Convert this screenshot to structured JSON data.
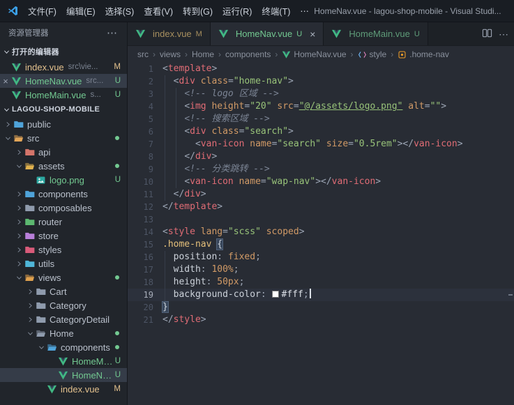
{
  "window": {
    "title": "HomeNav.vue - lagou-shop-mobile - Visual Studi..."
  },
  "menu_bar": {
    "items": [
      "文件(F)",
      "编辑(E)",
      "选择(S)",
      "查看(V)",
      "转到(G)",
      "运行(R)",
      "终端(T)",
      "⋯"
    ]
  },
  "icons": {
    "close": "×",
    "more": "⋯",
    "chevron_right": "›",
    "chevron_down": "⌄"
  },
  "colors": {
    "modified": "#E2C08D",
    "untracked": "#73C991",
    "accent_blue": "#3BA0E8",
    "editor_bg": "#282c34",
    "sidebar_bg": "#21252b",
    "tag": "#e06c75",
    "attribute": "#d19a66",
    "string": "#98c379",
    "selector": "#e5c07b"
  },
  "sidebar": {
    "title": "资源管理器",
    "sections": {
      "open_editors": "打开的编辑器",
      "project": "LAGOU-SHOP-MOBILE"
    },
    "open_editors": [
      {
        "name": "index.vue",
        "path": "src\\vie...",
        "badge": "M",
        "status": "m",
        "active": false
      },
      {
        "name": "HomeNav.vue",
        "path": "src...",
        "badge": "U",
        "status": "u",
        "active": true
      },
      {
        "name": "HomeMain.vue",
        "path": "s...",
        "badge": "U",
        "status": "u",
        "active": false
      }
    ],
    "tree": [
      {
        "label": "public",
        "depth": 0,
        "kind": "folder",
        "open": false,
        "color": "#4FA3D9"
      },
      {
        "label": "src",
        "depth": 0,
        "kind": "folder",
        "open": true,
        "color": "#E2A558",
        "dot": true
      },
      {
        "label": "api",
        "depth": 1,
        "kind": "folder",
        "open": false,
        "color": "#D4756A"
      },
      {
        "label": "assets",
        "depth": 1,
        "kind": "folder",
        "open": true,
        "color": "#E0B14E",
        "dot": true
      },
      {
        "label": "logo.png",
        "depth": 2,
        "kind": "file",
        "icon": "image",
        "badge": "U",
        "status": "u"
      },
      {
        "label": "components",
        "depth": 1,
        "kind": "folder",
        "open": false,
        "color": "#4FA3D9"
      },
      {
        "label": "composables",
        "depth": 1,
        "kind": "folder",
        "open": false,
        "color": "#8F9BAD"
      },
      {
        "label": "router",
        "depth": 1,
        "kind": "folder",
        "open": false,
        "color": "#5CB870"
      },
      {
        "label": "store",
        "depth": 1,
        "kind": "folder",
        "open": false,
        "color": "#B87FD9"
      },
      {
        "label": "styles",
        "depth": 1,
        "kind": "folder",
        "open": false,
        "color": "#D95B7A"
      },
      {
        "label": "utils",
        "depth": 1,
        "kind": "folder",
        "open": false,
        "color": "#4FB6D8"
      },
      {
        "label": "views",
        "depth": 1,
        "kind": "folder",
        "open": true,
        "color": "#E0A14E",
        "dot": true
      },
      {
        "label": "Cart",
        "depth": 2,
        "kind": "folder",
        "open": false,
        "color": "#8F9BAD"
      },
      {
        "label": "Category",
        "depth": 2,
        "kind": "folder",
        "open": false,
        "color": "#8F9BAD"
      },
      {
        "label": "CategoryDetail",
        "depth": 2,
        "kind": "folder",
        "open": false,
        "color": "#8F9BAD"
      },
      {
        "label": "Home",
        "depth": 2,
        "kind": "folder",
        "open": true,
        "color": "#8F9BAD",
        "dot": true
      },
      {
        "label": "components",
        "depth": 3,
        "kind": "folder",
        "open": true,
        "color": "#4FA3D9",
        "dot": true
      },
      {
        "label": "HomeMain...",
        "depth": 4,
        "kind": "file",
        "icon": "vue",
        "badge": "U",
        "status": "u"
      },
      {
        "label": "HomeNav.v...",
        "depth": 4,
        "kind": "file",
        "icon": "vue",
        "badge": "U",
        "status": "u",
        "selected": true
      },
      {
        "label": "index.vue",
        "depth": 3,
        "kind": "file",
        "icon": "vue",
        "badge": "M",
        "status": "m"
      }
    ]
  },
  "tabs": [
    {
      "label": "index.vue",
      "badge": "M",
      "status": "m",
      "active": false
    },
    {
      "label": "HomeNav.vue",
      "badge": "U",
      "status": "u",
      "active": true
    },
    {
      "label": "HomeMain.vue",
      "badge": "U",
      "status": "u",
      "active": false
    }
  ],
  "breadcrumb": {
    "items": [
      {
        "label": "src"
      },
      {
        "label": "views"
      },
      {
        "label": "Home"
      },
      {
        "label": "components"
      },
      {
        "label": "HomeNav.vue",
        "icon": "vue"
      },
      {
        "label": "style",
        "icon": "symbol-style"
      },
      {
        "label": ".home-nav",
        "icon": "symbol-class"
      }
    ]
  },
  "editor": {
    "lines": [
      {
        "n": 1,
        "t": [
          [
            "p",
            "<"
          ],
          [
            "g",
            "template"
          ],
          [
            "p",
            ">"
          ]
        ]
      },
      {
        "n": 2,
        "t": [
          [
            "ws",
            "  "
          ],
          [
            "p",
            "<"
          ],
          [
            "g",
            "div"
          ],
          [
            "ws",
            " "
          ],
          [
            "a",
            "class"
          ],
          [
            "p",
            "="
          ],
          [
            "s",
            "\"home-nav\""
          ],
          [
            "p",
            ">"
          ]
        ]
      },
      {
        "n": 3,
        "t": [
          [
            "ws",
            "    "
          ],
          [
            "cm",
            "<!-- logo 区域 -->"
          ]
        ]
      },
      {
        "n": 4,
        "t": [
          [
            "ws",
            "    "
          ],
          [
            "p",
            "<"
          ],
          [
            "g",
            "img"
          ],
          [
            "ws",
            " "
          ],
          [
            "a",
            "height"
          ],
          [
            "p",
            "="
          ],
          [
            "s",
            "\"20\""
          ],
          [
            "ws",
            " "
          ],
          [
            "a",
            "src"
          ],
          [
            "p",
            "="
          ],
          [
            "sl",
            "\"@/assets/logo.png\""
          ],
          [
            "ws",
            " "
          ],
          [
            "a",
            "alt"
          ],
          [
            "p",
            "="
          ],
          [
            "s",
            "\"\""
          ],
          [
            "p",
            ">"
          ]
        ]
      },
      {
        "n": 5,
        "t": [
          [
            "ws",
            "    "
          ],
          [
            "cm",
            "<!-- 搜索区域 -->"
          ]
        ]
      },
      {
        "n": 6,
        "t": [
          [
            "ws",
            "    "
          ],
          [
            "p",
            "<"
          ],
          [
            "g",
            "div"
          ],
          [
            "ws",
            " "
          ],
          [
            "a",
            "class"
          ],
          [
            "p",
            "="
          ],
          [
            "s",
            "\"search\""
          ],
          [
            "p",
            ">"
          ]
        ]
      },
      {
        "n": 7,
        "t": [
          [
            "ws",
            "      "
          ],
          [
            "p",
            "<"
          ],
          [
            "g",
            "van-icon"
          ],
          [
            "ws",
            " "
          ],
          [
            "a",
            "name"
          ],
          [
            "p",
            "="
          ],
          [
            "s",
            "\"search\""
          ],
          [
            "ws",
            " "
          ],
          [
            "a",
            "size"
          ],
          [
            "p",
            "="
          ],
          [
            "s",
            "\"0.5rem\""
          ],
          [
            "p",
            "></"
          ],
          [
            "g",
            "van-icon"
          ],
          [
            "p",
            ">"
          ]
        ]
      },
      {
        "n": 8,
        "t": [
          [
            "ws",
            "    "
          ],
          [
            "p",
            "</"
          ],
          [
            "g",
            "div"
          ],
          [
            "p",
            ">"
          ]
        ]
      },
      {
        "n": 9,
        "t": [
          [
            "ws",
            "    "
          ],
          [
            "cm",
            "<!-- 分类跳转 -->"
          ]
        ]
      },
      {
        "n": 10,
        "t": [
          [
            "ws",
            "    "
          ],
          [
            "p",
            "<"
          ],
          [
            "g",
            "van-icon"
          ],
          [
            "ws",
            " "
          ],
          [
            "a",
            "name"
          ],
          [
            "p",
            "="
          ],
          [
            "s",
            "\"wap-nav\""
          ],
          [
            "p",
            "></"
          ],
          [
            "g",
            "van-icon"
          ],
          [
            "p",
            ">"
          ]
        ]
      },
      {
        "n": 11,
        "t": [
          [
            "ws",
            "  "
          ],
          [
            "p",
            "</"
          ],
          [
            "g",
            "div"
          ],
          [
            "p",
            ">"
          ]
        ]
      },
      {
        "n": 12,
        "t": [
          [
            "p",
            "</"
          ],
          [
            "g",
            "template"
          ],
          [
            "p",
            ">"
          ]
        ]
      },
      {
        "n": 13,
        "t": []
      },
      {
        "n": 14,
        "t": [
          [
            "p",
            "<"
          ],
          [
            "g",
            "style"
          ],
          [
            "ws",
            " "
          ],
          [
            "a",
            "lang"
          ],
          [
            "p",
            "="
          ],
          [
            "s",
            "\"scss\""
          ],
          [
            "ws",
            " "
          ],
          [
            "a",
            "scoped"
          ],
          [
            "p",
            ">"
          ]
        ]
      },
      {
        "n": 15,
        "t": [
          [
            "se",
            ".home-nav"
          ],
          [
            "ws",
            " "
          ],
          [
            "b",
            "{"
          ]
        ]
      },
      {
        "n": 16,
        "t": [
          [
            "ws",
            "  "
          ],
          [
            "pr",
            "position"
          ],
          [
            "p",
            ":"
          ],
          [
            "ws",
            " "
          ],
          [
            "v",
            "fixed"
          ],
          [
            "p",
            ";"
          ]
        ]
      },
      {
        "n": 17,
        "t": [
          [
            "ws",
            "  "
          ],
          [
            "pr",
            "width"
          ],
          [
            "p",
            ":"
          ],
          [
            "ws",
            " "
          ],
          [
            "v",
            "100%"
          ],
          [
            "p",
            ";"
          ]
        ]
      },
      {
        "n": 18,
        "t": [
          [
            "ws",
            "  "
          ],
          [
            "pr",
            "height"
          ],
          [
            "p",
            ":"
          ],
          [
            "ws",
            " "
          ],
          [
            "v",
            "50px"
          ],
          [
            "p",
            ";"
          ]
        ]
      },
      {
        "n": 19,
        "cur": true,
        "cursor": true,
        "t": [
          [
            "ws",
            "  "
          ],
          [
            "pr",
            "background-color"
          ],
          [
            "p",
            ":"
          ],
          [
            "ws",
            " "
          ],
          [
            "sw",
            "#ffffff"
          ],
          [
            "w",
            "#fff"
          ],
          [
            "p",
            ";"
          ]
        ]
      },
      {
        "n": 20,
        "t": [
          [
            "b",
            "}"
          ]
        ]
      },
      {
        "n": 21,
        "t": [
          [
            "p",
            "</"
          ],
          [
            "g",
            "style"
          ],
          [
            "p",
            ">"
          ]
        ]
      }
    ]
  }
}
